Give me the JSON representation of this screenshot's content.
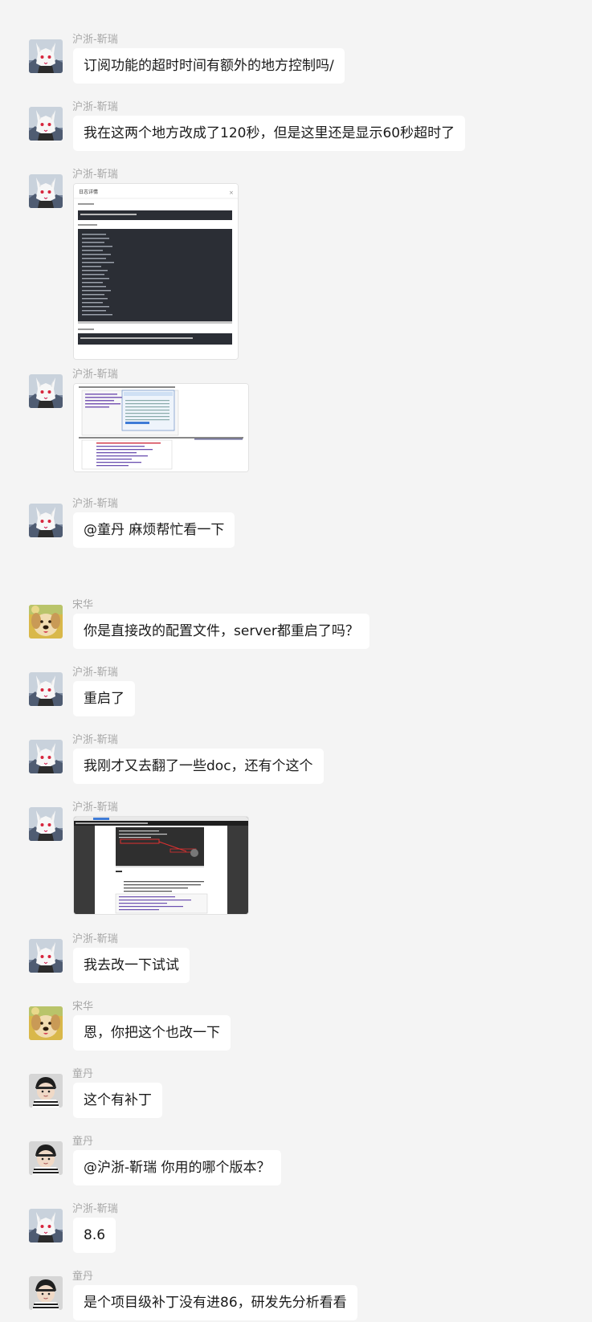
{
  "conversation": {
    "messages": [
      {
        "sender": "沪浙-靳瑞",
        "avatar": "white-fox-avatar",
        "type": "text",
        "text": "订阅功能的超时时间有额外的地方控制吗/"
      },
      {
        "sender": "沪浙-靳瑞",
        "avatar": "white-fox-avatar",
        "type": "text",
        "text": "我在这两个地方改成了120秒，但是这里还是显示60秒超时了"
      },
      {
        "sender": "沪浙-靳瑞",
        "avatar": "white-fox-avatar",
        "type": "image",
        "image": "log-detail-dialog-screenshot",
        "caption_title": "日志详情"
      },
      {
        "sender": "沪浙-靳瑞",
        "avatar": "white-fox-avatar",
        "type": "image",
        "image": "config-files-screenshot"
      },
      {
        "sender": "沪浙-靳瑞",
        "avatar": "white-fox-avatar",
        "type": "text",
        "text": "@童丹 麻烦帮忙看一下"
      },
      {
        "sender": "宋华",
        "avatar": "golden-dog-avatar",
        "type": "text",
        "text": "你是直接改的配置文件，server都重启了吗？"
      },
      {
        "sender": "沪浙-靳瑞",
        "avatar": "white-fox-avatar",
        "type": "text",
        "text": "重启了"
      },
      {
        "sender": "沪浙-靳瑞",
        "avatar": "white-fox-avatar",
        "type": "text",
        "text": "我刚才又去翻了一些doc，还有个这个"
      },
      {
        "sender": "沪浙-靳瑞",
        "avatar": "white-fox-avatar",
        "type": "image",
        "image": "documentation-screenshot"
      },
      {
        "sender": "沪浙-靳瑞",
        "avatar": "white-fox-avatar",
        "type": "text",
        "text": "我去改一下试试"
      },
      {
        "sender": "宋华",
        "avatar": "golden-dog-avatar",
        "type": "text",
        "text": "恩，你把这个也改一下"
      },
      {
        "sender": "童丹",
        "avatar": "baby-avatar",
        "type": "text",
        "text": "这个有补丁"
      },
      {
        "sender": "童丹",
        "avatar": "baby-avatar",
        "type": "text",
        "text": "@沪浙-靳瑞  你用的哪个版本？"
      },
      {
        "sender": "沪浙-靳瑞",
        "avatar": "white-fox-avatar",
        "type": "text",
        "text": "8.6"
      },
      {
        "sender": "童丹",
        "avatar": "baby-avatar",
        "type": "text",
        "text": "是个项目级补丁没有进86，研发先分析看看"
      }
    ]
  },
  "colors": {
    "background": "#f4f4f4",
    "bubble": "#ffffff",
    "name": "#a8a8a8",
    "text": "#1a1a1a"
  }
}
